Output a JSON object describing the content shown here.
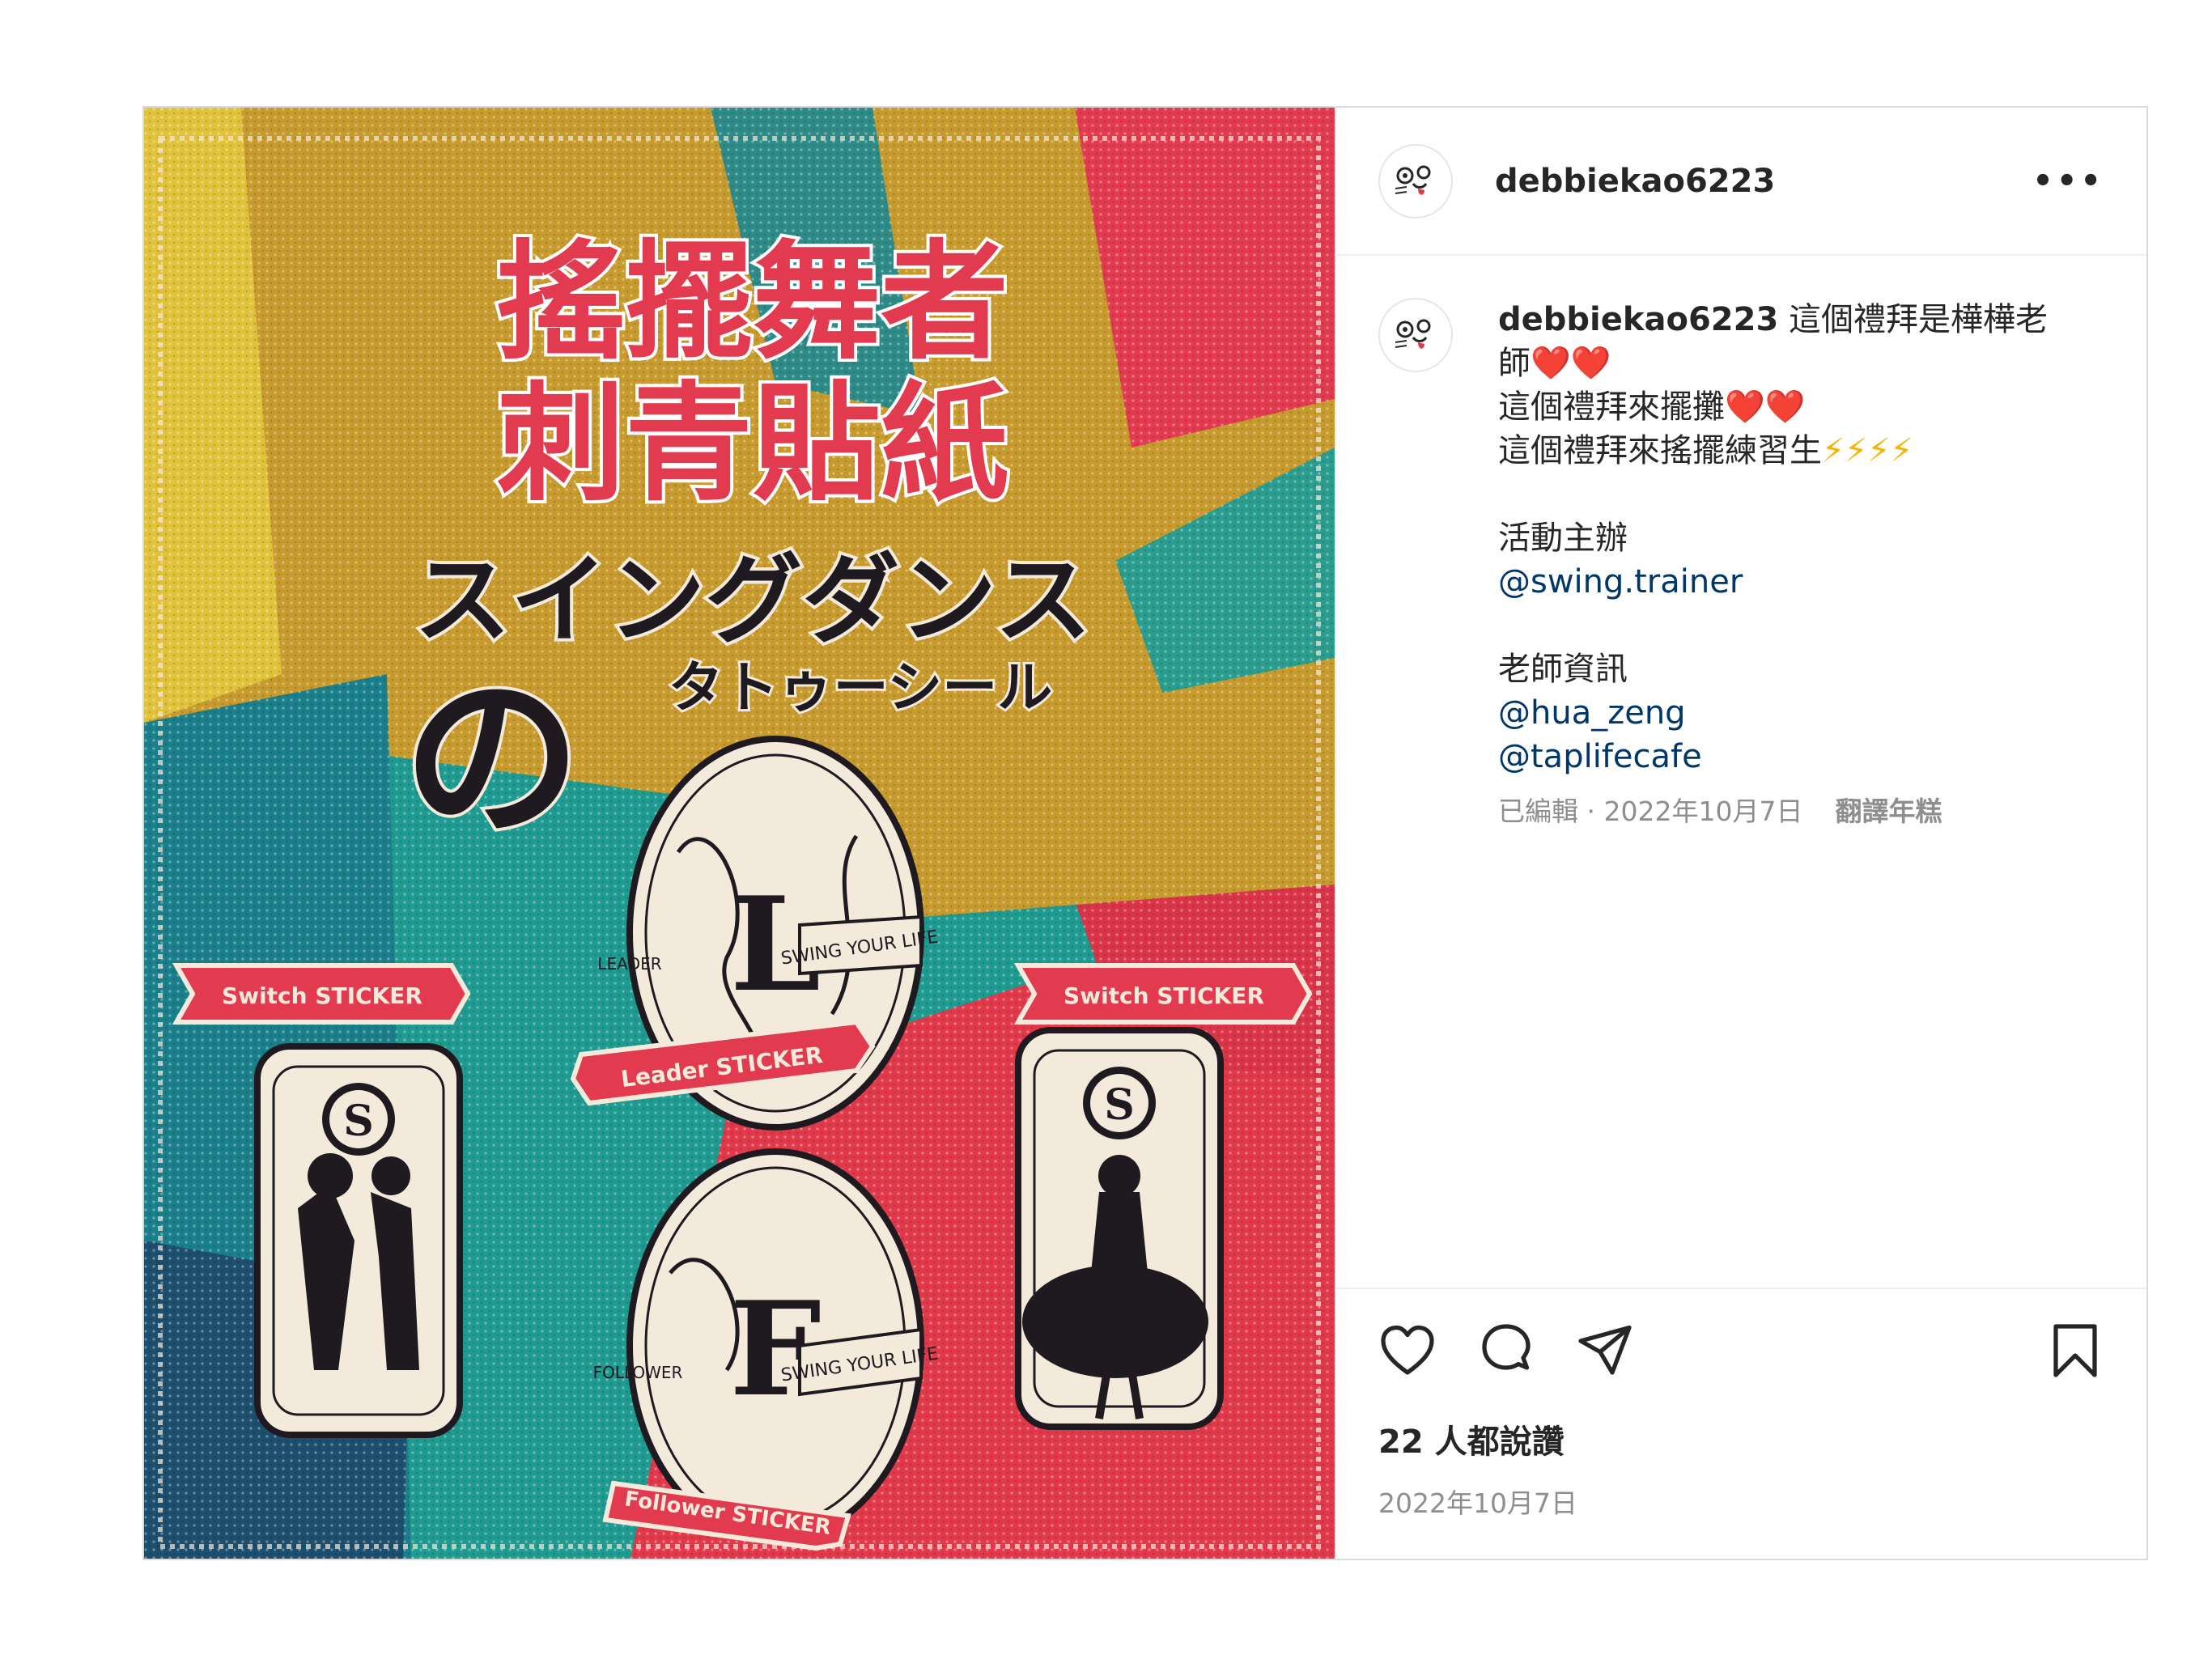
{
  "post": {
    "username": "debbiekao6223",
    "more_icon": "more-options-icon",
    "caption": {
      "username": "debbiekao6223",
      "line1": "這個禮拜是樺樺老師",
      "line2": "這個禮拜來擺攤",
      "line3": "這個禮拜來搖擺練習生",
      "organizer_label": "活動主辦",
      "organizer_mention": "@swing.trainer",
      "teacher_label": "老師資訊",
      "teacher_mention_1": "@hua_zeng",
      "teacher_mention_2": "@taplifecafe",
      "heart_emoji": "❤️",
      "bolt_emoji": "⚡"
    },
    "meta": {
      "edited_date": "已編輯 · 2022年10月7日",
      "translate": "翻譯年糕"
    },
    "likes": "22 人都說讚",
    "date": "2022年10月7日",
    "icons": [
      "heart-icon",
      "comment-icon",
      "share-icon",
      "bookmark-icon"
    ]
  },
  "image": {
    "title_line1": "搖擺舞者",
    "title_line2": "刺青貼紙",
    "katakana_line1": "スイングダンス",
    "katakana_no": "の",
    "katakana_line2": "タトゥーシール",
    "ribbon_switch_left": "Switch STICKER",
    "ribbon_leader": "Leader STICKER",
    "ribbon_switch_right": "Switch STICKER",
    "ribbon_follower": "Follower STICKER",
    "badge_leader": "L",
    "badge_follower": "F",
    "badge_switch": "S",
    "banner_text": "SWING YOUR LIFE",
    "leader_tag": "LEADER",
    "follower_tag": "FOLLOWER",
    "colors": {
      "red": "#e23a4e",
      "teal": "#1f9a90",
      "mustard": "#c79a2d",
      "cream": "#f3eadb",
      "ink": "#1e1a20"
    }
  }
}
